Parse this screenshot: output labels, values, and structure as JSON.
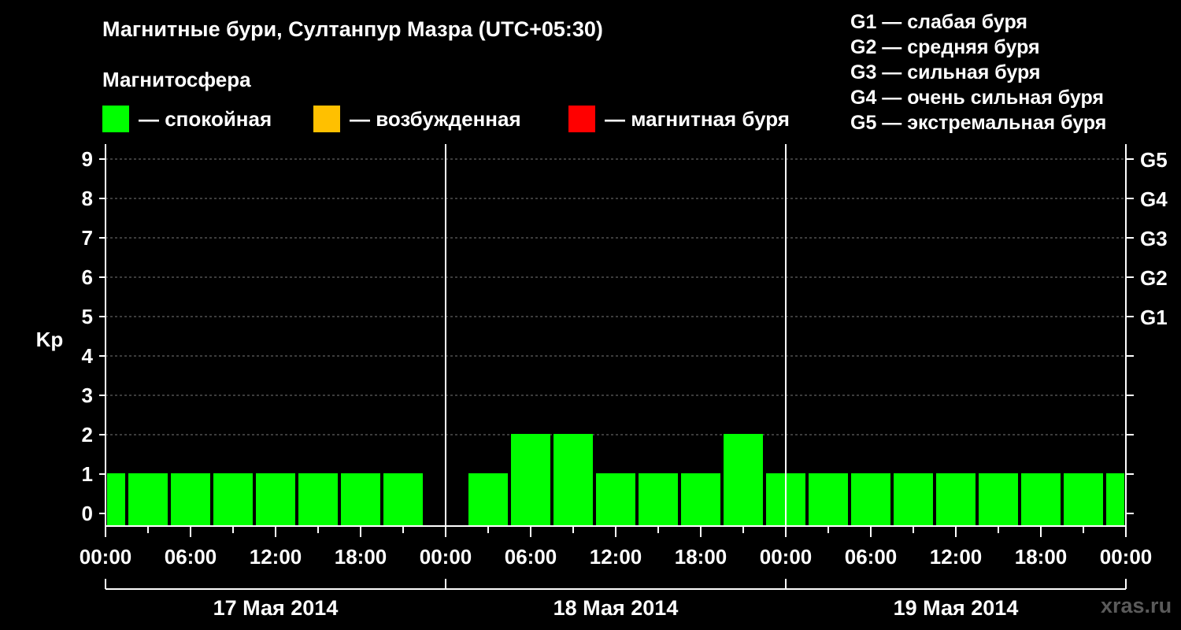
{
  "header": {
    "title": "Магнитные бури, Султанпур Мазра (UTC+05:30)",
    "subtitle": "Магнитосфера"
  },
  "legend": {
    "items": [
      {
        "label": "— спокойная",
        "color": "#00ff00"
      },
      {
        "label": "— возбужденная",
        "color": "#ffc000"
      },
      {
        "label": "— магнитная буря",
        "color": "#ff0000"
      }
    ]
  },
  "storm_levels": [
    "G1 — слабая буря",
    "G2 — средняя буря",
    "G3 — сильная буря",
    "G4 — очень сильная буря",
    "G5 — экстремальная буря"
  ],
  "watermark": "xras.ru",
  "chart_data": {
    "type": "bar",
    "title": "Магнитные бури, Султанпур Мазра (UTC+05:30)",
    "ylabel": "Kp",
    "ylim": [
      0,
      9
    ],
    "yticks": [
      "0",
      "1",
      "2",
      "3",
      "4",
      "5",
      "6",
      "7",
      "8",
      "9"
    ],
    "right_axis_ticks": [
      {
        "value": 5,
        "label": "G1"
      },
      {
        "value": 6,
        "label": "G2"
      },
      {
        "value": 7,
        "label": "G3"
      },
      {
        "value": 8,
        "label": "G4"
      },
      {
        "value": 9,
        "label": "G5"
      }
    ],
    "xticks": [
      "00:00",
      "06:00",
      "12:00",
      "18:00",
      "00:00",
      "06:00",
      "12:00",
      "18:00",
      "00:00",
      "06:00",
      "12:00",
      "18:00",
      "00:00"
    ],
    "days": [
      "17 Мая 2014",
      "18 Мая 2014",
      "19 Мая 2014"
    ],
    "bar_color": "#00ff00",
    "grid": true,
    "bars": [
      {
        "start_hour": 0,
        "end_hour": 1.5,
        "value": 1
      },
      {
        "start_hour": 1.5,
        "end_hour": 4.5,
        "value": 1
      },
      {
        "start_hour": 4.5,
        "end_hour": 7.5,
        "value": 1
      },
      {
        "start_hour": 7.5,
        "end_hour": 10.5,
        "value": 1
      },
      {
        "start_hour": 10.5,
        "end_hour": 13.5,
        "value": 1
      },
      {
        "start_hour": 13.5,
        "end_hour": 16.5,
        "value": 1
      },
      {
        "start_hour": 16.5,
        "end_hour": 19.5,
        "value": 1
      },
      {
        "start_hour": 19.5,
        "end_hour": 22.5,
        "value": 1
      },
      {
        "start_hour": 22.5,
        "end_hour": 25.5,
        "value": 0
      },
      {
        "start_hour": 25.5,
        "end_hour": 28.5,
        "value": 1
      },
      {
        "start_hour": 28.5,
        "end_hour": 31.5,
        "value": 2
      },
      {
        "start_hour": 31.5,
        "end_hour": 34.5,
        "value": 2
      },
      {
        "start_hour": 34.5,
        "end_hour": 37.5,
        "value": 1
      },
      {
        "start_hour": 37.5,
        "end_hour": 40.5,
        "value": 1
      },
      {
        "start_hour": 40.5,
        "end_hour": 43.5,
        "value": 1
      },
      {
        "start_hour": 43.5,
        "end_hour": 46.5,
        "value": 2
      },
      {
        "start_hour": 46.5,
        "end_hour": 49.5,
        "value": 1
      },
      {
        "start_hour": 49.5,
        "end_hour": 52.5,
        "value": 1
      },
      {
        "start_hour": 52.5,
        "end_hour": 55.5,
        "value": 1
      },
      {
        "start_hour": 55.5,
        "end_hour": 58.5,
        "value": 1
      },
      {
        "start_hour": 58.5,
        "end_hour": 61.5,
        "value": 1
      },
      {
        "start_hour": 61.5,
        "end_hour": 64.5,
        "value": 1
      },
      {
        "start_hour": 64.5,
        "end_hour": 67.5,
        "value": 1
      },
      {
        "start_hour": 67.5,
        "end_hour": 70.5,
        "value": 1
      },
      {
        "start_hour": 70.5,
        "end_hour": 72,
        "value": 1
      }
    ]
  }
}
